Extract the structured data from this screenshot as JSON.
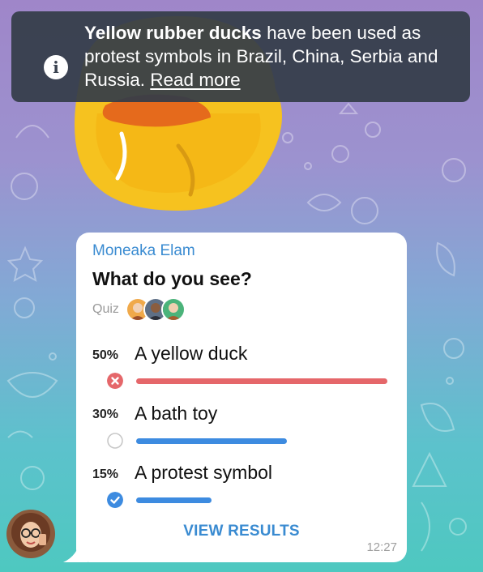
{
  "toast": {
    "icon": "info-icon",
    "bold_text": "Yellow rubber ducks",
    "text": " have been used as protest symbols in Brazil, China, Serbia and Russia. ",
    "link_label": "Read more"
  },
  "poll": {
    "sender": "Moneaka Elam",
    "question": "What do you see?",
    "type_label": "Quiz",
    "options": [
      {
        "percent_label": "50%",
        "percent": 50,
        "text": "A yellow duck",
        "state": "wrong",
        "bar_color": "#e5676a"
      },
      {
        "percent_label": "30%",
        "percent": 30,
        "text": "A bath toy",
        "state": "none",
        "bar_color": "#3d8be0"
      },
      {
        "percent_label": "15%",
        "percent": 15,
        "text": "A protest symbol",
        "state": "correct",
        "bar_color": "#3d8be0"
      }
    ],
    "action_label": "VIEW RESULTS",
    "time": "12:27"
  },
  "colors": {
    "accent": "#3a8bd1",
    "wrong": "#e5676a",
    "bar": "#3d8be0",
    "toast_bg": "#343c48"
  }
}
